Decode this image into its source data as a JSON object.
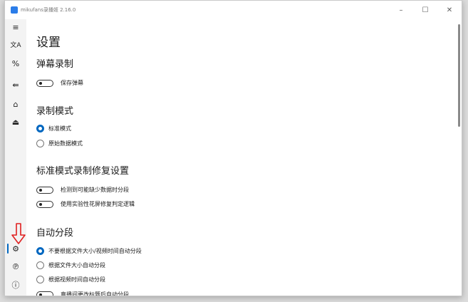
{
  "window": {
    "title": "mikufans录播姬 2.16.0"
  },
  "controls": {
    "minimize": "–",
    "maximize": "☐",
    "close": "✕"
  },
  "sidebar": {
    "items": [
      {
        "name": "menu-icon",
        "glyph": "≡"
      },
      {
        "name": "translate-icon",
        "glyph": "文A"
      },
      {
        "name": "slash-percent-icon",
        "glyph": "%"
      },
      {
        "name": "announce-icon",
        "glyph": "⇚"
      },
      {
        "name": "home-icon",
        "glyph": "⌂"
      },
      {
        "name": "drive-icon",
        "glyph": "⏏"
      }
    ],
    "bottom": [
      {
        "name": "settings-icon",
        "glyph": "⚙"
      },
      {
        "name": "link-icon",
        "glyph": "℗"
      },
      {
        "name": "info-icon",
        "glyph": "ⓘ"
      }
    ]
  },
  "page": {
    "title": "设置",
    "danmaku": {
      "title": "弹幕录制",
      "toggle_label": "保存弹幕"
    },
    "mode": {
      "title": "录制模式",
      "options": [
        "标准模式",
        "原始数据模式"
      ],
      "selected": 0
    },
    "fix": {
      "title": "标准模式录制修复设置",
      "toggles": [
        "检测到可能缺少数据时分段",
        "使用实验性花屏修复判定逻辑"
      ]
    },
    "split": {
      "title": "自动分段",
      "options": [
        "不要根据文件大小/视频时间自动分段",
        "根据文件大小自动分段",
        "根据视频时间自动分段"
      ],
      "selected": 0,
      "toggle_label": "直播间更改标题后自动分段"
    }
  },
  "colors": {
    "accent": "#0067c0",
    "annotation_arrow": "#e02020"
  }
}
